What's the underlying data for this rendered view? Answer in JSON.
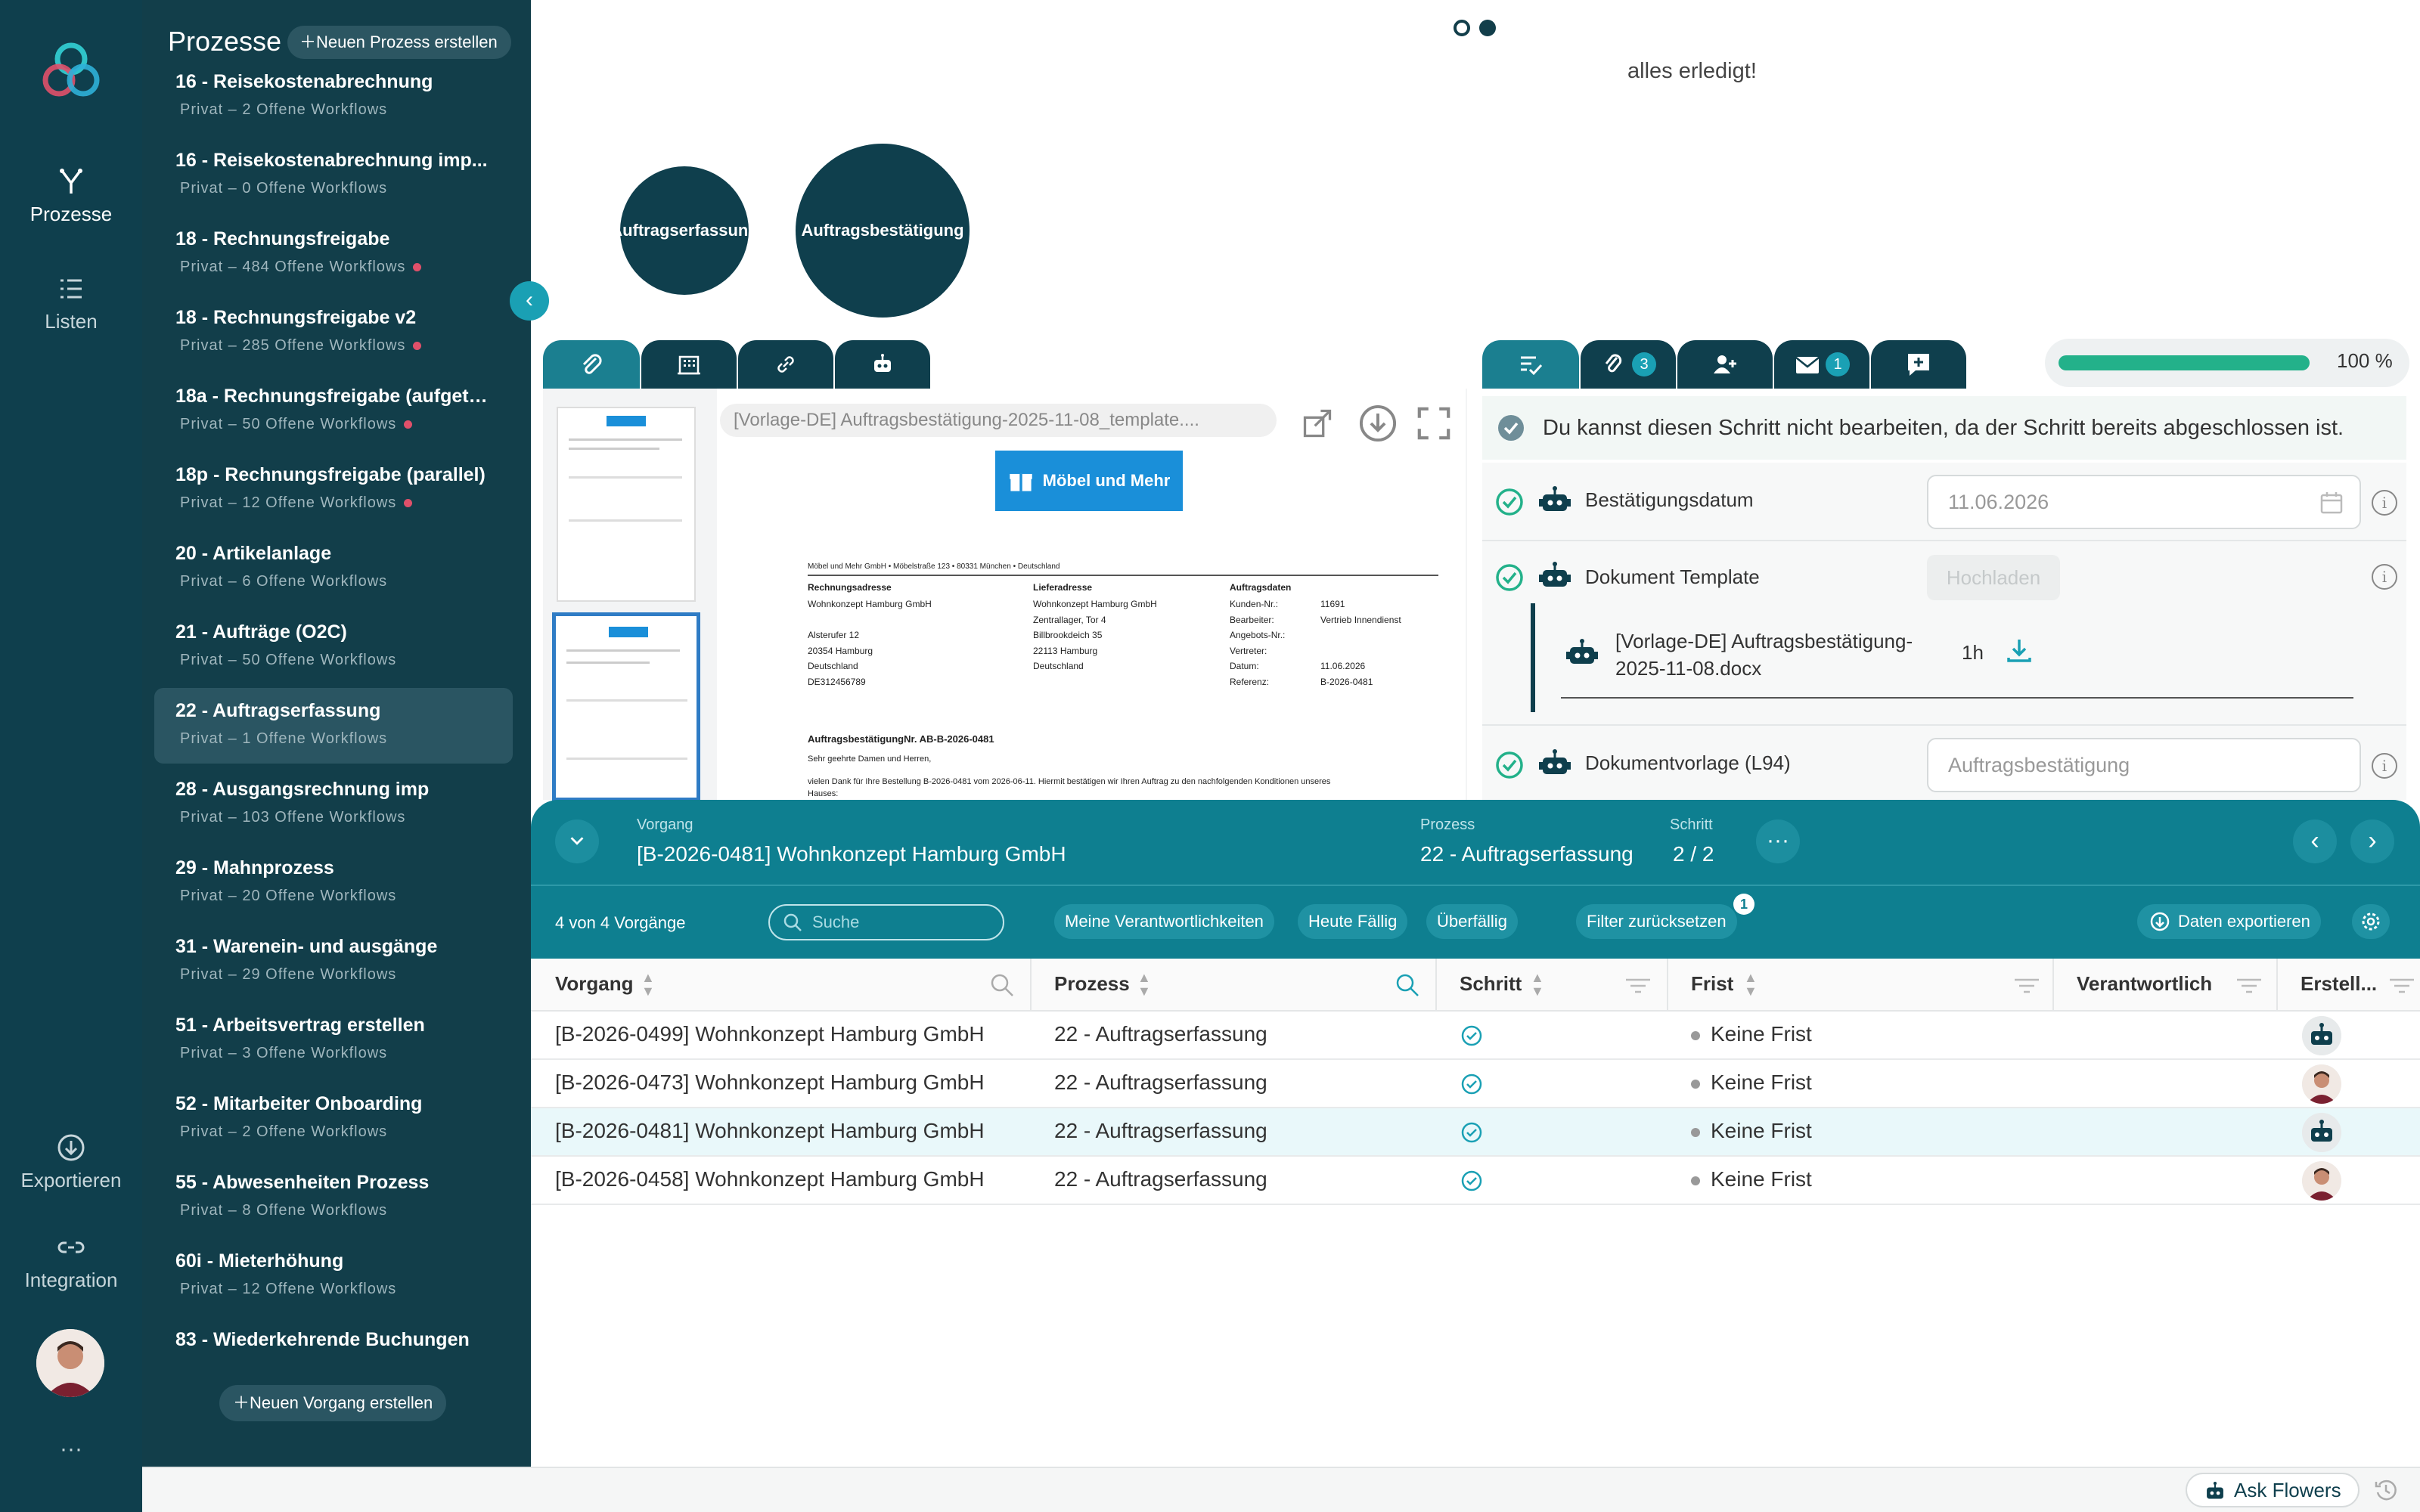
{
  "rail": {
    "processes_label": "Prozesse",
    "lists_label": "Listen",
    "export_label": "Exportieren",
    "integration_label": "Integration",
    "more_label": "···"
  },
  "sidebar": {
    "title": "Prozesse",
    "new_process_label": "Neuen Prozess erstellen",
    "new_case_label": "Neuen Vorgang erstellen",
    "collapse_glyph": "‹",
    "items": [
      {
        "name": "16 - Reisekostenabrechnung",
        "sub": "Privat – 2 Offene Workflows",
        "dot": false
      },
      {
        "name": "16 - Reisekostenabrechnung imp...",
        "sub": "Privat – 0 Offene Workflows",
        "dot": false
      },
      {
        "name": "18 - Rechnungsfreigabe",
        "sub": "Privat – 484 Offene Workflows",
        "dot": true
      },
      {
        "name": "18 - Rechnungsfreigabe v2",
        "sub": "Privat – 285 Offene Workflows",
        "dot": true
      },
      {
        "name": "18a - Rechnungsfreigabe (aufgete...",
        "sub": "Privat – 50 Offene Workflows",
        "dot": true
      },
      {
        "name": "18p - Rechnungsfreigabe (parallel)",
        "sub": "Privat – 12 Offene Workflows",
        "dot": true
      },
      {
        "name": "20 - Artikelanlage",
        "sub": "Privat – 6 Offene Workflows",
        "dot": false
      },
      {
        "name": "21 - Aufträge (O2C)",
        "sub": "Privat – 50 Offene Workflows",
        "dot": false
      },
      {
        "name": "22 - Auftragserfassung",
        "sub": "Privat – 1 Offene Workflows",
        "dot": false,
        "active": true
      },
      {
        "name": "28 - Ausgangsrechnung imp",
        "sub": "Privat – 103 Offene Workflows",
        "dot": false
      },
      {
        "name": "29 - Mahnprozess",
        "sub": "Privat – 20 Offene Workflows",
        "dot": false
      },
      {
        "name": "31 - Warenein- und ausgänge",
        "sub": "Privat – 29 Offene Workflows",
        "dot": false
      },
      {
        "name": "51 - Arbeitsvertrag erstellen",
        "sub": "Privat – 3 Offene Workflows",
        "dot": false
      },
      {
        "name": "52 - Mitarbeiter Onboarding",
        "sub": "Privat – 2 Offene Workflows",
        "dot": false
      },
      {
        "name": "55 - Abwesenheiten Prozess",
        "sub": "Privat – 8 Offene Workflows",
        "dot": false
      },
      {
        "name": "60i - Mieterhöhung",
        "sub": "Privat – 12 Offene Workflows",
        "dot": false
      },
      {
        "name": "83 - Wiederkehrende Buchungen",
        "sub": "",
        "dot": false
      }
    ]
  },
  "flow": {
    "status_text": "alles erledigt!",
    "node1": "Auftragserfassung",
    "node2": "Auftragsbestätigung"
  },
  "doc": {
    "filename": "[Vorlage-DE] Auftragsbestätigung-2025-11-08_template....",
    "logo_text": "Möbel und Mehr",
    "sender_line": "Möbel und Mehr GmbH • Möbelstraße 123 • 80331 München • Deutschland",
    "billing_title": "Rechnungsadresse",
    "billing": [
      "Wohnkonzept Hamburg GmbH",
      "",
      "Alsterufer 12",
      "20354 Hamburg",
      "Deutschland",
      "DE312456789"
    ],
    "delivery_title": "Lieferadresse",
    "delivery": [
      "Wohnkonzept Hamburg GmbH",
      "Zentrallager, Tor 4",
      "Billbrookdeich 35",
      "22113 Hamburg",
      "Deutschland"
    ],
    "order_title": "Auftragsdaten",
    "order_keys": [
      "Kunden-Nr.:",
      "Bearbeiter:",
      "Angebots-Nr.:",
      "Vertreter:",
      "Datum:",
      "Referenz:"
    ],
    "order_vals": [
      "11691",
      "Vertrieb Innendienst",
      "",
      "",
      "11.06.2026",
      "B-2026-0481"
    ],
    "heading": "AuftragsbestätigungNr. AB-B-2026-0481",
    "greeting": "Sehr geehrte Damen und Herren,",
    "body": "vielen Dank für Ihre Bestellung B-2026-0481 vom 2026-06-11. Hiermit bestätigen wir Ihren Auftrag zu den nachfolgenden Konditionen unseres",
    "body2": "Hauses:"
  },
  "task": {
    "progress_percent": 100,
    "progress_label": "100 %",
    "attachments_count": "3",
    "mail_count": "1",
    "notice": "Du kannst diesen Schritt nicht bearbeiten, da der Schritt bereits abgeschlossen ist.",
    "fields": {
      "date_label": "Bestätigungsdatum",
      "date_value": "11.06.2026",
      "template_label": "Dokument Template",
      "upload_label": "Hochladen",
      "file_name_1": "[Vorlage-DE] Auftragsbestätigung-",
      "file_name_2": "2025-11-08.docx",
      "file_age": "1h",
      "doc_template_label": "Dokumentvorlage (L94)",
      "doc_template_value": "Auftragsbestätigung"
    }
  },
  "case_bar": {
    "vorgang_label": "Vorgang",
    "vorgang_value": "[B-2026-0481] Wohnkonzept Hamburg GmbH",
    "prozess_label": "Prozess",
    "prozess_value": "22 - Auftragserfassung",
    "schritt_label": "Schritt",
    "schritt_value": "2 / 2",
    "more": "···"
  },
  "filters": {
    "count_text": "4 von 4 Vorgänge",
    "search_placeholder": "Suche",
    "chip_mine": "Meine Verantwortlichkeiten",
    "chip_today": "Heute Fällig",
    "chip_overdue": "Überfällig",
    "chip_reset": "Filter zurücksetzen",
    "reset_badge": "1",
    "export_label": "Daten exportieren"
  },
  "table": {
    "columns": [
      "Vorgang",
      "Prozess",
      "Schritt",
      "Frist",
      "Verantwortlich",
      "Erstell..."
    ],
    "rows": [
      {
        "vorgang": "[B-2026-0499] Wohnkonzept Hamburg GmbH",
        "prozess": "22 - Auftragserfassung",
        "frist": "Keine Frist",
        "creator": "robot"
      },
      {
        "vorgang": "[B-2026-0473] Wohnkonzept Hamburg GmbH",
        "prozess": "22 - Auftragserfassung",
        "frist": "Keine Frist",
        "creator": "person"
      },
      {
        "vorgang": "[B-2026-0481] Wohnkonzept Hamburg GmbH",
        "prozess": "22 - Auftragserfassung",
        "frist": "Keine Frist",
        "creator": "robot",
        "selected": true
      },
      {
        "vorgang": "[B-2026-0458] Wohnkonzept Hamburg GmbH",
        "prozess": "22 - Auftragserfassung",
        "frist": "Keine Frist",
        "creator": "person"
      }
    ]
  },
  "footer": {
    "ask_label": "Ask Flowers"
  },
  "colors": {
    "rail": "#0f3f4d",
    "accent": "#1aa0b4",
    "teal_bar": "#0e7f90",
    "progress": "#23b18a",
    "alert_dot": "#e0506a"
  }
}
